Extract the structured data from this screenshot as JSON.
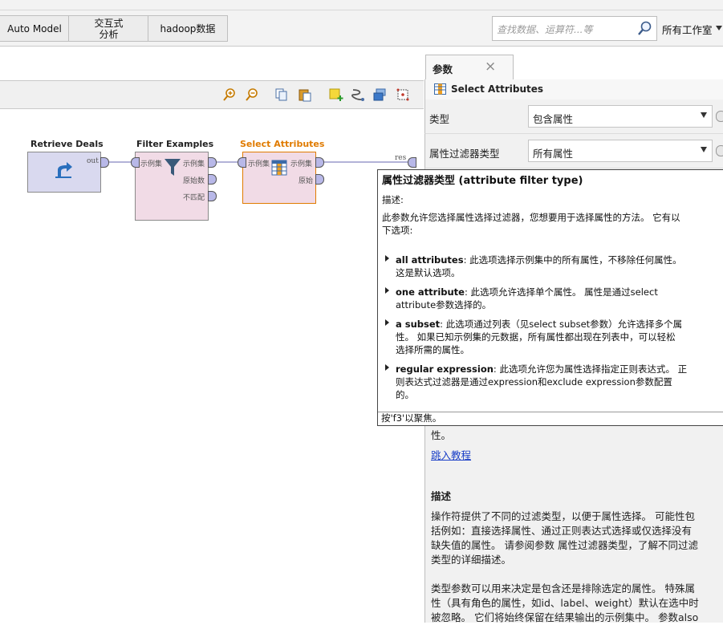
{
  "toolbar": {
    "buttons": [
      "Auto Model",
      "交互式\n分析",
      "hadoop数据"
    ],
    "search_placeholder": "查找数据、运算符...等",
    "workspace": "所有工作室"
  },
  "process": {
    "operators": [
      {
        "name": "Retrieve Deals",
        "ports_out": [
          "out"
        ]
      },
      {
        "name": "Filter Examples",
        "ports_in": [
          "示例集"
        ],
        "ports_out": [
          "示例集",
          "原始数",
          "不匹配"
        ]
      },
      {
        "name": "Select Attributes",
        "ports_in": [
          "示例集"
        ],
        "ports_out": [
          "示例集",
          "原始"
        ]
      }
    ],
    "result_port": "res"
  },
  "params": {
    "tab_label": "参数",
    "operator_title": "Select Attributes",
    "rows": [
      {
        "label": "类型",
        "value": "包含属性"
      },
      {
        "label": "属性过滤器类型",
        "value": "所有属性"
      }
    ]
  },
  "tooltip": {
    "title": "属性过滤器类型 (attribute filter type)",
    "desc_label": "描述:",
    "intro_1": "此参数允许您选择属性选择过滤器，您想要用于选择属性的方法。 它有以",
    "intro_2": "下选项:",
    "options": [
      {
        "name": "all attributes",
        "l1": ": 此选项选择示例集中的所有属性，不移除任何属性。",
        "l2": "这是默认选项。",
        "l3": ""
      },
      {
        "name": "one attribute",
        "l1": ": 此选项允许选择单个属性。 属性是通过select",
        "l2": "attribute参数选择的。",
        "l3": ""
      },
      {
        "name": "a subset",
        "l1": ": 此选项通过列表（见select subset参数）允许选择多个属",
        "l2": "性。 如果已知示例集的元数据，所有属性都出现在列表中，可以轻松",
        "l3": "选择所需的属性。"
      },
      {
        "name": "regular expression",
        "l1": ": 此选项允许您为属性选择指定正则表达式。 正",
        "l2": "则表达式过滤器是通过expression和exclude expression参数配置",
        "l3": "的。"
      }
    ],
    "footer": "按'f3'以聚焦。"
  },
  "help": {
    "partial_line": "性。",
    "tutorial_link": "跳入教程",
    "desc_heading": "描述",
    "para1": [
      "操作符提供了不同的过滤类型，以便于属性选择。 可能性包",
      "括例如：直接选择属性、通过正则表达式选择或仅选择没有",
      "缺失值的属性。 请参阅参数 属性过滤器类型，了解不同过滤",
      "类型的详细描述。"
    ],
    "para2": [
      "类型参数可以用来决定是包含还是排除选定的属性。 特殊属",
      "性（具有角色的属性，如id、label、weight）默认在选中时",
      "被忽略。 它们将始终保留在结果输出的示例集中。 参数also"
    ]
  },
  "colors": {
    "accent": "#e07b00",
    "port": "#b8b8e8",
    "op_fill": "#f1dbe6",
    "retrieve_fill": "#d9d9ef"
  }
}
